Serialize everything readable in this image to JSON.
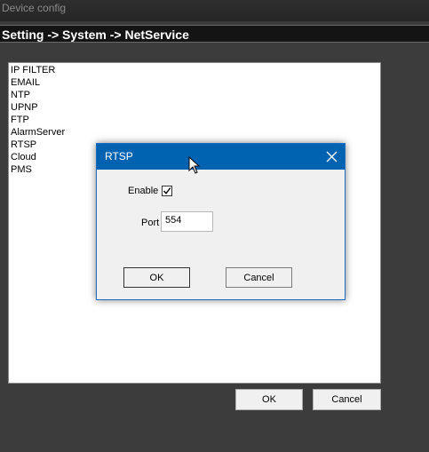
{
  "window": {
    "title": "Device config"
  },
  "breadcrumb": "Setting -> System -> NetService",
  "services": [
    "IP FILTER",
    "EMAIL",
    "NTP",
    "UPNP",
    "FTP",
    "AlarmServer",
    "RTSP",
    "Cloud",
    "PMS"
  ],
  "main_buttons": {
    "ok": "OK",
    "cancel": "Cancel"
  },
  "dialog": {
    "title": "RTSP",
    "enable_label": "Enable",
    "enable_checked": true,
    "port_label": "Port",
    "port_value": "554",
    "ok": "OK",
    "cancel": "Cancel"
  },
  "colors": {
    "dialog_titlebar": "#0063b1",
    "background": "#3c3c3c"
  },
  "icons": {
    "close": "close-icon",
    "checkmark": "checkmark-icon",
    "cursor": "mouse-cursor-icon"
  }
}
